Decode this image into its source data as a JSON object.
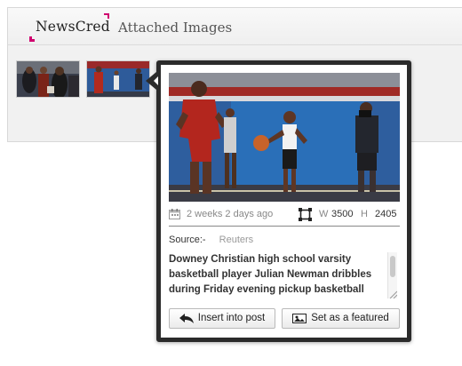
{
  "header": {
    "logo_text": "NewsCred",
    "title": "Attached Images"
  },
  "thumbnails": [
    {
      "name": "basketball-thumb-1"
    },
    {
      "name": "basketball-thumb-2"
    }
  ],
  "popover": {
    "date_text": "2 weeks 2 days ago",
    "width_label": "W",
    "width_value": "3500",
    "height_label": "H",
    "height_value": "2405",
    "source_label": "Source:-",
    "source_value": "Reuters",
    "caption": "Downey Christian high school varsity basketball player Julian Newman dribbles during Friday evening pickup basketball",
    "insert_label": "Insert into post",
    "featured_label": "Set as a featured"
  },
  "colors": {
    "brand_accent": "#d0006f",
    "popover_border": "#2b2b2b"
  },
  "icons": {
    "calendar": "calendar-icon",
    "crop": "crop-icon",
    "insert": "reply-arrow-icon",
    "featured": "image-icon"
  }
}
